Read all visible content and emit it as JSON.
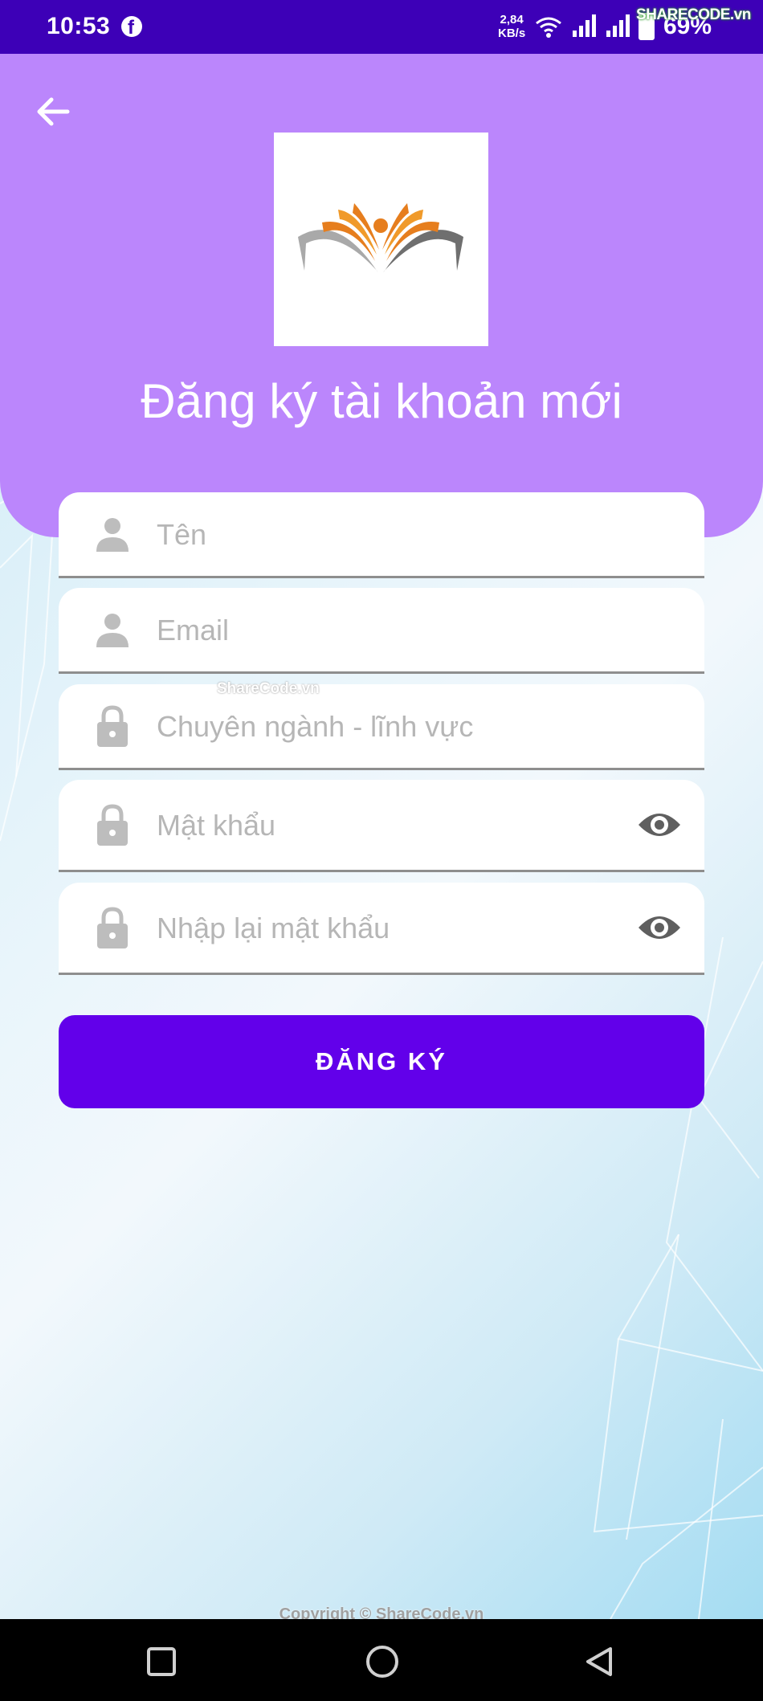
{
  "status_bar": {
    "time": "10:53",
    "net_speed_value": "2,84",
    "net_speed_unit": "KB/s",
    "battery": "69%",
    "watermark": "SHARECODE.vn",
    "icons": [
      "facebook-icon",
      "wifi-icon",
      "signal-icon",
      "signal-icon",
      "battery-icon"
    ]
  },
  "header": {
    "title": "Đăng ký tài khoản mới",
    "background_color": "#bb86fc"
  },
  "form": {
    "name_placeholder": "Tên",
    "email_placeholder": "Email",
    "major_placeholder": "Chuyên ngành - lĩnh vực",
    "password_placeholder": "Mật khẩu",
    "confirm_password_placeholder": "Nhập lại mật khẩu",
    "submit_label": "ĐĂNG KÝ",
    "submit_color": "#6200ea"
  },
  "watermark_mid": "ShareCode.vn",
  "copyright": "Copyright © ShareCode.vn",
  "nav_bar": {
    "icons": [
      "recent-apps-icon",
      "home-icon",
      "back-icon"
    ]
  }
}
